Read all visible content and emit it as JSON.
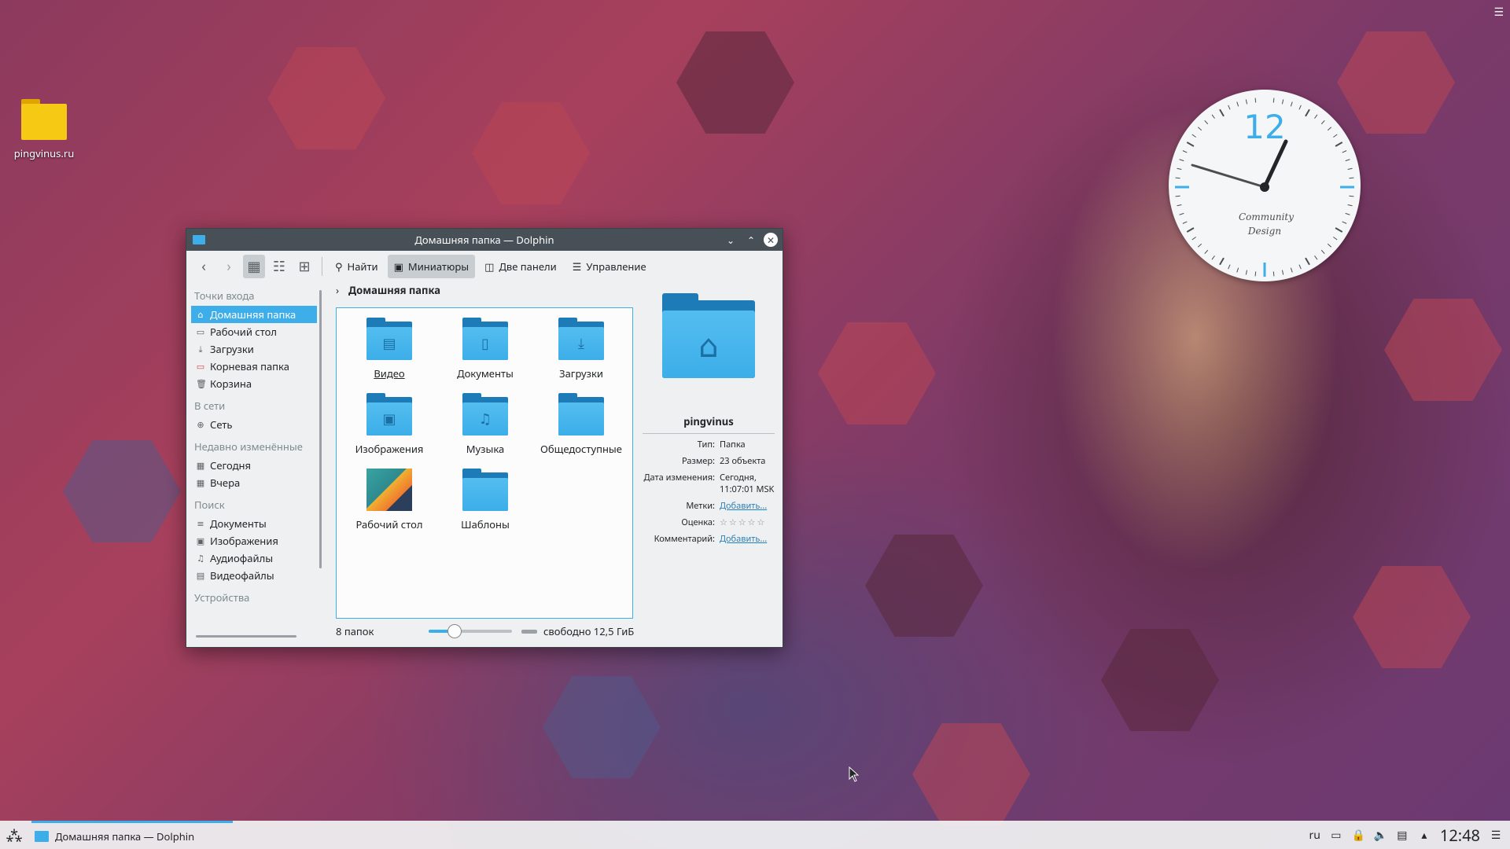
{
  "desktop": {
    "icon_label": "pingvinus.ru",
    "clock_number": "12",
    "clock_brand": "Community",
    "clock_brand2": "Design"
  },
  "window": {
    "title": "Домашняя папка — Dolphin",
    "toolbar": {
      "find": "Найти",
      "thumbnails": "Миниатюры",
      "split": "Две панели",
      "manage": "Управление"
    },
    "places": {
      "sec_entry": "Точки входа",
      "home": "Домашняя папка",
      "desktop": "Рабочий стол",
      "downloads": "Загрузки",
      "root": "Корневая папка",
      "trash": "Корзина",
      "sec_network": "В сети",
      "network": "Сеть",
      "sec_recent": "Недавно изменённые",
      "today": "Сегодня",
      "yesterday": "Вчера",
      "sec_search": "Поиск",
      "s_docs": "Документы",
      "s_images": "Изображения",
      "s_audio": "Аудиофайлы",
      "s_video": "Видеофайлы",
      "sec_devices": "Устройства"
    },
    "breadcrumb": "Домашняя папка",
    "folders": [
      "Видео",
      "Документы",
      "Загрузки",
      "Изображения",
      "Музыка",
      "Общедоступные",
      "Рабочий стол",
      "Шаблоны"
    ],
    "info": {
      "name": "pingvinus",
      "type_k": "Тип:",
      "type_v": "Папка",
      "size_k": "Размер:",
      "size_v": "23 объекта",
      "date_k": "Дата изменения:",
      "date_v": "Сегодня, 11:07:01 MSK",
      "tags_k": "Метки:",
      "tags_v": "Добавить...",
      "rating_k": "Оценка:",
      "rating_v": "☆☆☆☆☆",
      "comment_k": "Комментарий:",
      "comment_v": "Добавить..."
    },
    "status": {
      "count": "8 папок",
      "free": "свободно 12,5 ГиБ",
      "zoom_level": 0.3
    }
  },
  "taskbar": {
    "task_label": "Домашняя папка — Dolphin",
    "lang": "ru",
    "time": "12:48"
  }
}
